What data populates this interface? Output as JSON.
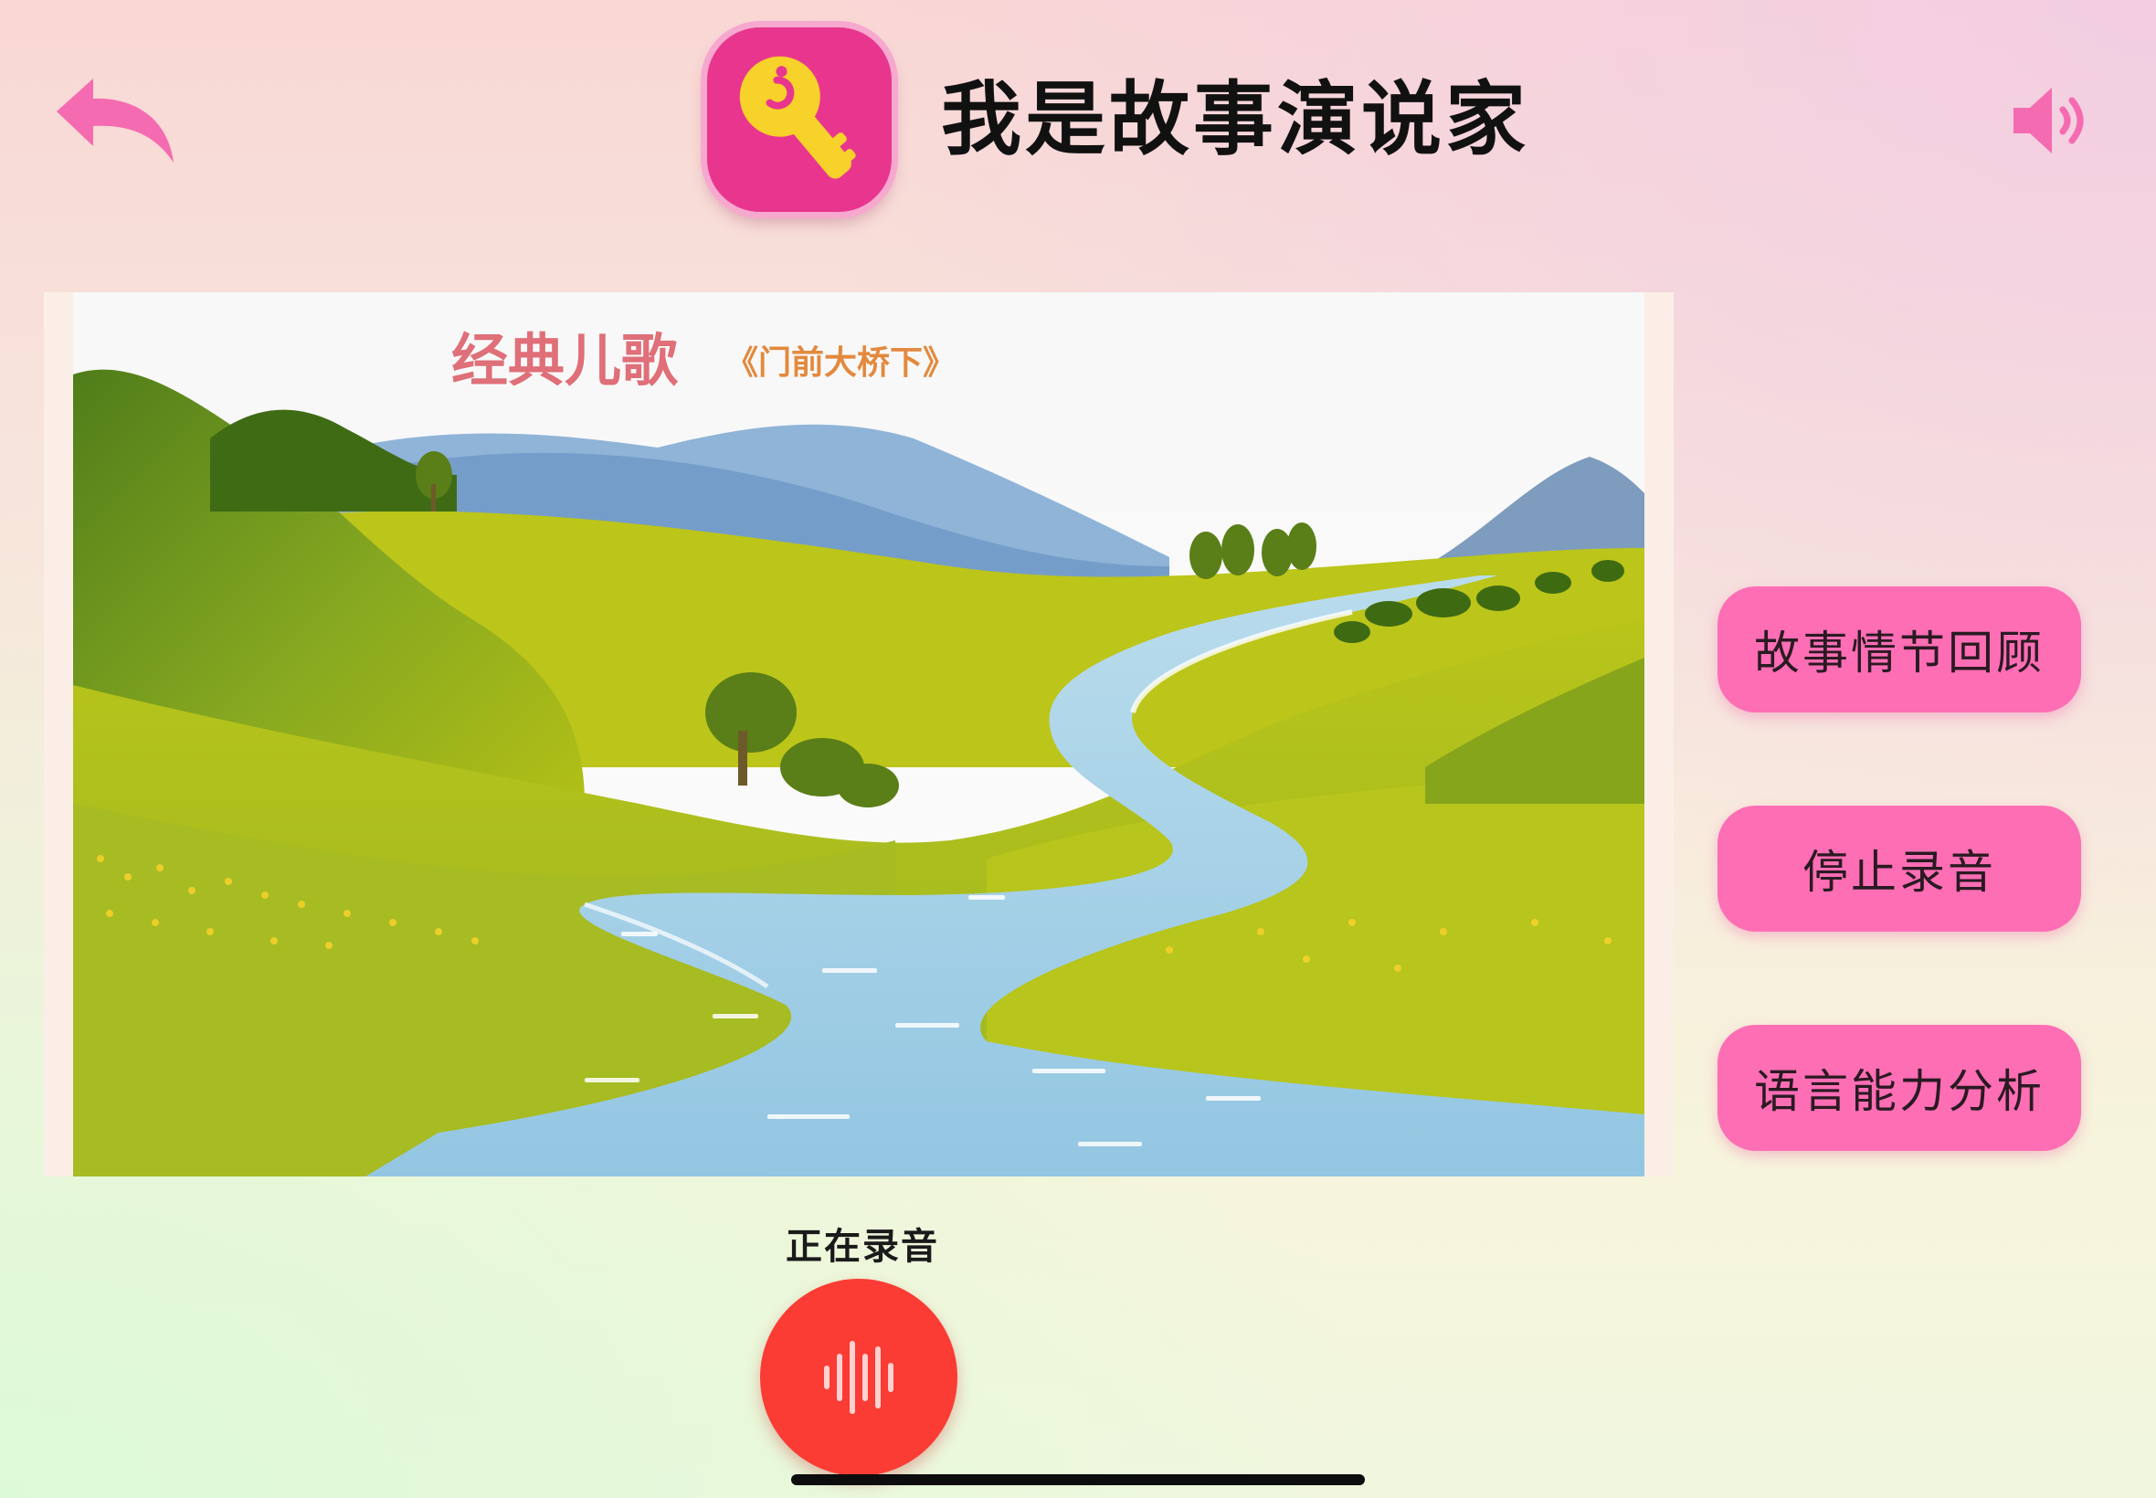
{
  "header": {
    "title": "我是故事演说家",
    "back_icon": "back-arrow-icon",
    "app_icon": "key-icon",
    "sound_icon": "speaker-icon"
  },
  "scene": {
    "title": "经典儿歌",
    "subtitle": "《门前大桥下》"
  },
  "actions": {
    "review_label": "故事情节回顾",
    "stop_label": "停止录音",
    "analysis_label": "语言能力分析"
  },
  "recording": {
    "status": "正在录音",
    "icon": "soundwave-icon"
  },
  "colors": {
    "accent_pink": "#fd6eb5",
    "icon_pink": "#e8368e",
    "record_red": "#fa3c35",
    "title_pink": "#df6f78",
    "subtitle_orange": "#e3893d"
  }
}
